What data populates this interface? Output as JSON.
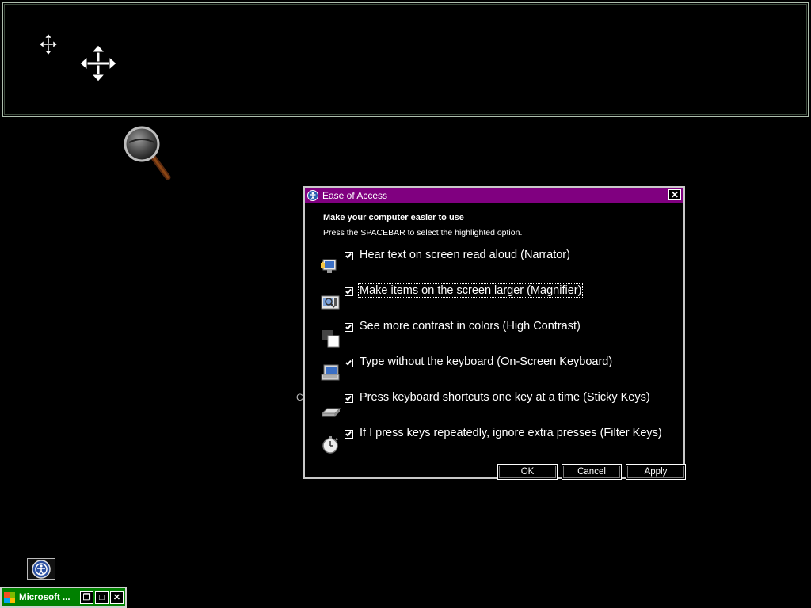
{
  "dialog": {
    "title": "Ease of Access",
    "heading": "Make your computer easier to use",
    "instruction": "Press the SPACEBAR to select the highlighted option.",
    "options": [
      {
        "label": "Hear text on screen read aloud (Narrator)",
        "checked": true,
        "icon": "narrator-icon"
      },
      {
        "label": "Make items on the screen larger (Magnifier)",
        "checked": true,
        "icon": "magnifier-icon"
      },
      {
        "label": "See more contrast in colors (High Contrast)",
        "checked": true,
        "icon": "high-contrast-icon"
      },
      {
        "label": "Type without the keyboard (On-Screen Keyboard)",
        "checked": true,
        "icon": "on-screen-keyboard-icon"
      },
      {
        "label": "Press keyboard shortcuts one key at a time (Sticky Keys)",
        "checked": true,
        "icon": "sticky-keys-icon"
      },
      {
        "label": "If I press keys repeatedly, ignore extra presses (Filter Keys)",
        "checked": true,
        "icon": "filter-keys-icon"
      }
    ],
    "buttons": {
      "ok": "OK",
      "cancel": "Cancel",
      "apply": "Apply"
    },
    "close_glyph": "✕"
  },
  "stray_text": "C",
  "taskbar": {
    "window_title": "Microsoft ...",
    "controls": {
      "restore": "❐",
      "maximize": "□",
      "close": "✕"
    }
  },
  "colors": {
    "titlebar": "#800080",
    "taskbar_item": "#008000",
    "background": "#000000"
  }
}
